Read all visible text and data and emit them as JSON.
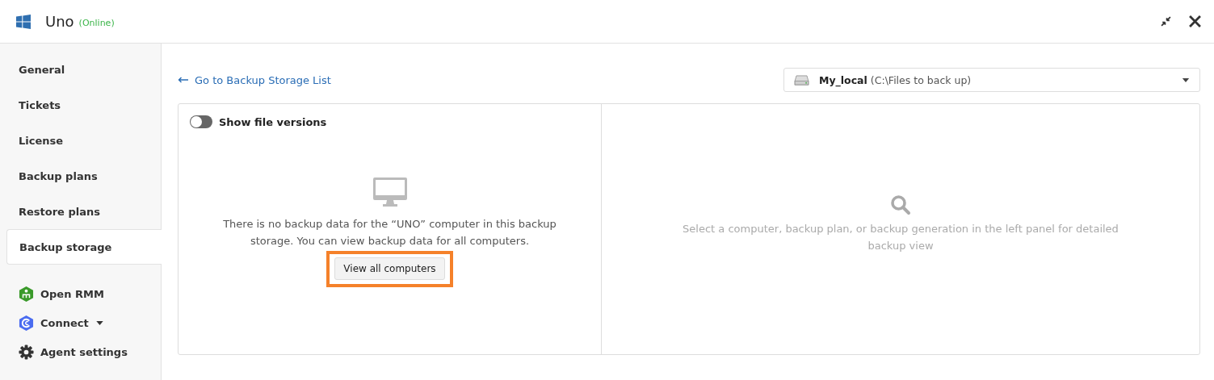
{
  "window": {
    "title": "Uno",
    "status": "(Online)"
  },
  "sidebar": {
    "items": [
      {
        "label": "General",
        "selected": false
      },
      {
        "label": "Tickets",
        "selected": false
      },
      {
        "label": "License",
        "selected": false
      },
      {
        "label": "Backup plans",
        "selected": false
      },
      {
        "label": "Restore plans",
        "selected": false
      },
      {
        "label": "Backup storage",
        "selected": true
      }
    ],
    "tools": [
      {
        "label": "Open RMM",
        "kind": "rmm"
      },
      {
        "label": "Connect",
        "kind": "connect"
      },
      {
        "label": "Agent settings",
        "kind": "settings"
      }
    ]
  },
  "back_link": "Go to Backup Storage List",
  "storage_select": {
    "name": "My_local",
    "path": "(C:\\Files to back up)"
  },
  "left_panel": {
    "toggle": {
      "label": "Show file versions",
      "on": false
    },
    "message": "There is no backup data for the “UNO” computer in this backup storage. You can view backup data for all computers.",
    "button": "View all computers",
    "highlighted": true
  },
  "right_panel": {
    "message": "Select a computer, backup plan, or backup generation in the left panel for detailed backup view"
  }
}
